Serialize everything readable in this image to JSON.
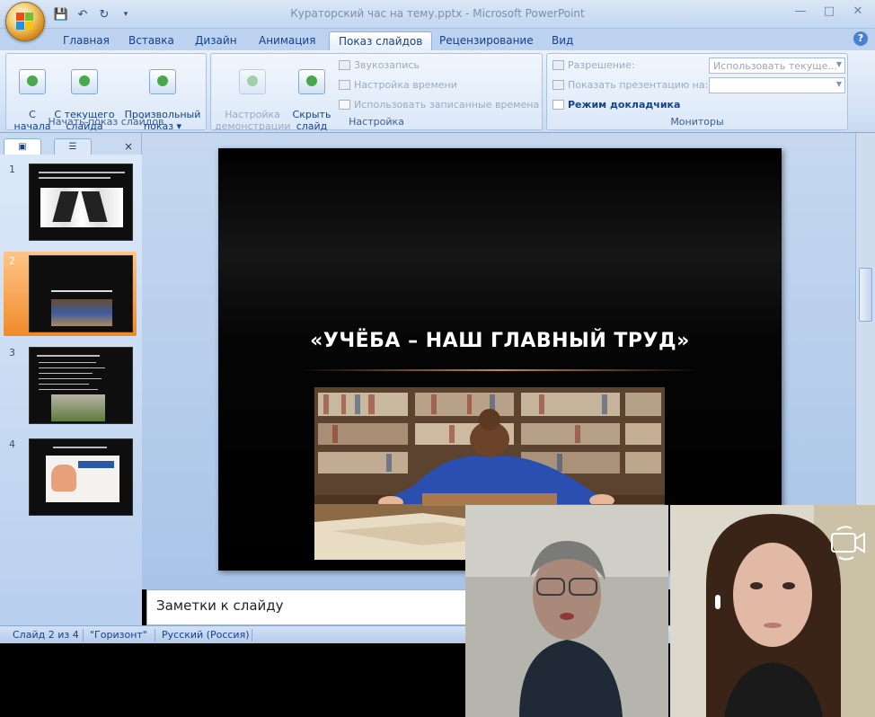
{
  "window": {
    "title": "Кураторский час на тему.pptx - Microsoft PowerPoint"
  },
  "tabs": [
    {
      "label": "Главная"
    },
    {
      "label": "Вставка"
    },
    {
      "label": "Дизайн"
    },
    {
      "label": "Анимация"
    },
    {
      "label": "Показ слайдов",
      "active": true
    },
    {
      "label": "Рецензирование"
    },
    {
      "label": "Вид"
    }
  ],
  "ribbon": {
    "start_group": {
      "label": "Начать показ слайдов",
      "from_start": "С\nначала",
      "from_current": "С текущего\nслайда",
      "custom": "Произвольный\nпоказ ▾"
    },
    "setup_group": {
      "label": "Настройка",
      "setup_show": "Настройка\nдемонстрации",
      "hide_slide": "Скрыть\nслайд",
      "record_narration": "Звукозапись",
      "rehearse_timings": "Настройка времени",
      "use_timings": "Использовать записанные времена"
    },
    "monitors_group": {
      "label": "Мониторы",
      "resolution": "Разрешение:",
      "resolution_value": "Использовать текуще...",
      "show_on": "Показать презентацию на:",
      "show_on_value": "",
      "presenter_view": "Режим докладчика"
    }
  },
  "slides": [
    {
      "num": "1"
    },
    {
      "num": "2",
      "selected": true
    },
    {
      "num": "3"
    },
    {
      "num": "4"
    }
  ],
  "current_slide": {
    "title": "«УЧЁБА – НАШ ГЛАВНЫЙ ТРУД»"
  },
  "notes": {
    "placeholder": "Заметки к слайду"
  },
  "status": {
    "slide_counter": "Слайд 2 из 4",
    "theme": "\"Горизонт\"",
    "language": "Русский (Россия)"
  },
  "colors": {
    "ribbon_bg": "#d4e3f6",
    "selected_thumb": "#f08a2b",
    "slide_bg": "#000000"
  }
}
